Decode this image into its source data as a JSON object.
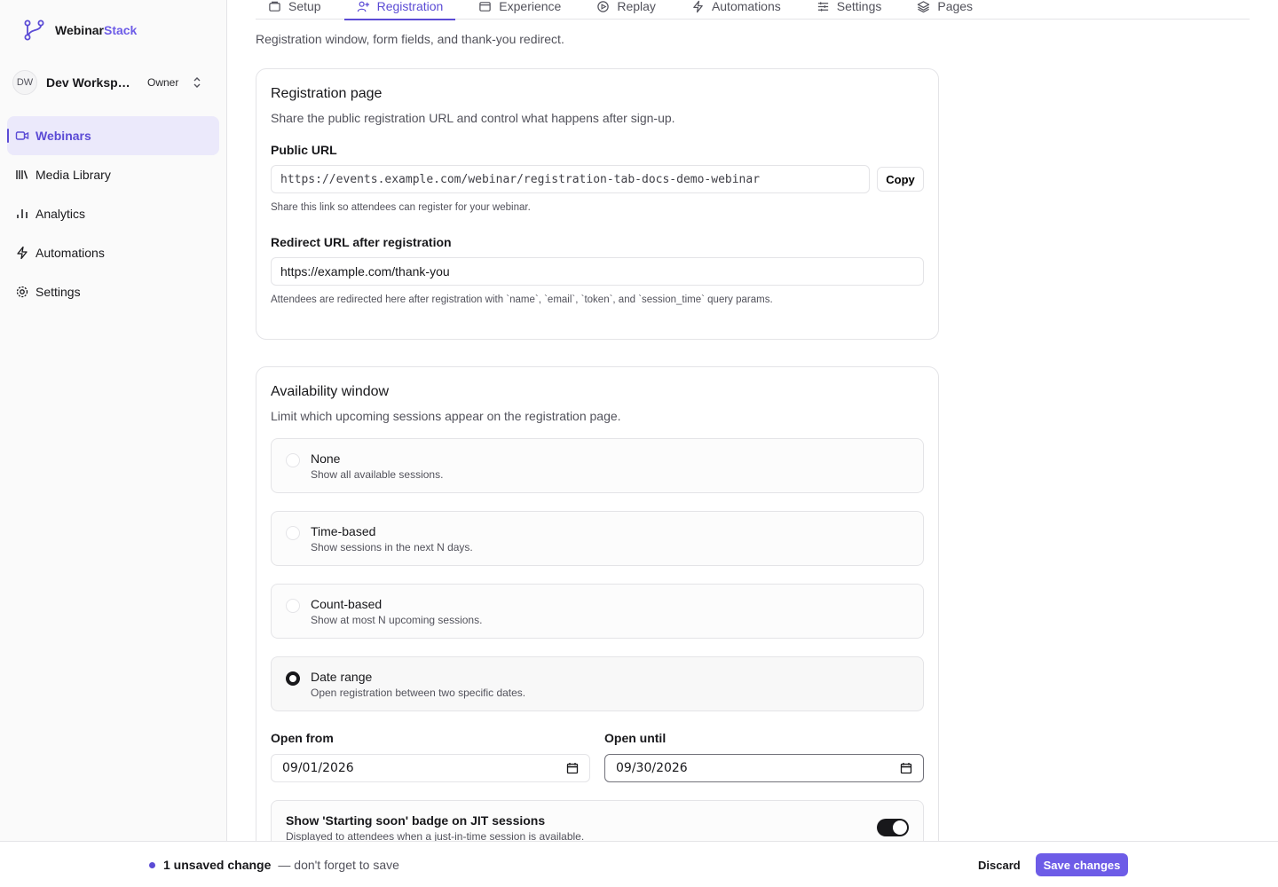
{
  "brand": {
    "name_part1": "Webinar",
    "name_part2": "Stack",
    "accent_color": "#6d5ce7"
  },
  "workspace": {
    "initials": "DW",
    "name": "Dev Workspace",
    "role": "Owner"
  },
  "sidebar": {
    "items": [
      {
        "label": "Webinars",
        "icon": "video-icon",
        "active": true
      },
      {
        "label": "Media Library",
        "icon": "library-icon",
        "active": false
      },
      {
        "label": "Analytics",
        "icon": "bar-chart-icon",
        "active": false
      },
      {
        "label": "Automations",
        "icon": "lightning-icon",
        "active": false
      },
      {
        "label": "Settings",
        "icon": "gear-icon",
        "active": false
      }
    ]
  },
  "tabs": [
    {
      "label": "Setup",
      "icon": "rectangle-icon",
      "active": false
    },
    {
      "label": "Registration",
      "icon": "user-plus-icon",
      "active": true
    },
    {
      "label": "Experience",
      "icon": "window-icon",
      "active": false
    },
    {
      "label": "Replay",
      "icon": "play-circle-icon",
      "active": false
    },
    {
      "label": "Automations",
      "icon": "lightning-icon",
      "active": false
    },
    {
      "label": "Settings",
      "icon": "sliders-icon",
      "active": false
    },
    {
      "label": "Pages",
      "icon": "layers-icon",
      "active": false
    }
  ],
  "page_description": "Registration window, form fields, and thank-you redirect.",
  "registration_card": {
    "title": "Registration page",
    "subtitle": "Share the public registration URL and control what happens after sign-up.",
    "public_url_label": "Public URL",
    "public_url_value": "https://events.example.com/webinar/registration-tab-docs-demo-webinar",
    "copy_label": "Copy",
    "public_url_help": "Share this link so attendees can register for your webinar.",
    "redirect_label": "Redirect URL after registration",
    "redirect_value": "https://example.com/thank-you",
    "redirect_help": "Attendees are redirected here after registration with `name`, `email`, `token`, and `session_time` query params."
  },
  "availability_card": {
    "title": "Availability window",
    "subtitle": "Limit which upcoming sessions appear on the registration page.",
    "options": [
      {
        "title": "None",
        "desc": "Show all available sessions.",
        "selected": false
      },
      {
        "title": "Time-based",
        "desc": "Show sessions in the next N days.",
        "selected": false
      },
      {
        "title": "Count-based",
        "desc": "Show at most N upcoming sessions.",
        "selected": false
      },
      {
        "title": "Date range",
        "desc": "Open registration between two specific dates.",
        "selected": true
      }
    ],
    "open_from_label": "Open from",
    "open_from_value": "09/01/2026",
    "open_until_label": "Open until",
    "open_until_value": "09/30/2026",
    "badge_toggle_title": "Show 'Starting soon' badge on JIT sessions",
    "badge_toggle_desc": "Displayed to attendees when a just-in-time session is available.",
    "badge_toggle_on": true
  },
  "savebar": {
    "unsaved_count": "1 unsaved change",
    "unsaved_note": "— don't forget to save",
    "discard_label": "Discard",
    "save_label": "Save changes"
  }
}
